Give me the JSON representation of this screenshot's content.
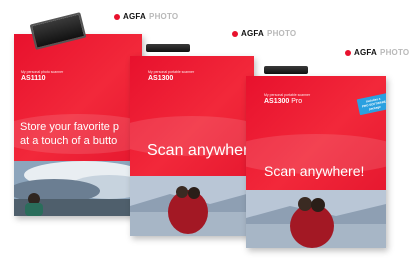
{
  "brand": {
    "agfa": "AGFA",
    "photo": "PHOTO"
  },
  "boxes": [
    {
      "tagline": "My personal photo scanner",
      "model": "AS1110",
      "model_suffix": "",
      "headline": "Store your favorite p\nat a touch of a butto"
    },
    {
      "tagline": "My personal portable scanner",
      "model": "AS1300",
      "model_suffix": "",
      "headline": "Scan anywhere!"
    },
    {
      "tagline": "My personal portable scanner",
      "model": "AS1300",
      "model_suffix": " Pro",
      "headline": "Scan anywhere!",
      "badge": "Includes a\nPRO SOFTWARE\npackage"
    }
  ],
  "colors": {
    "box_red": "#e8112d",
    "badge_blue": "#2aa0e0"
  }
}
